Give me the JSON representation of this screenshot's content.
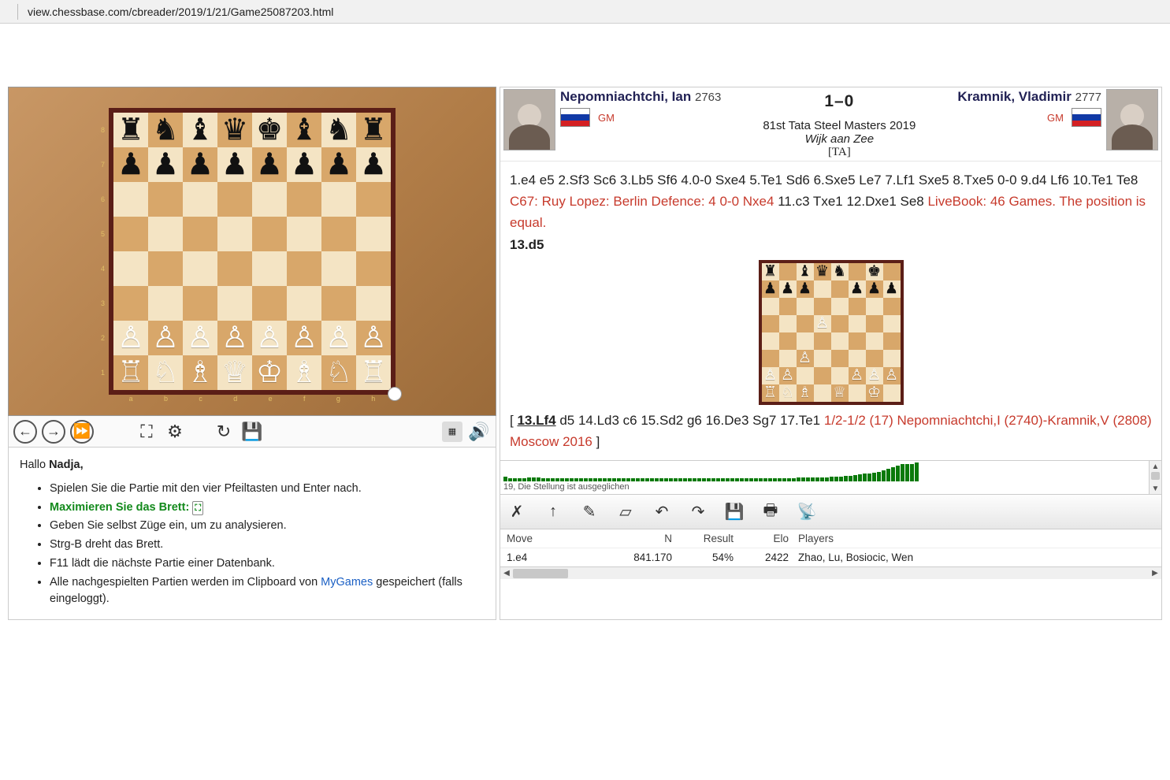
{
  "url_display": "view.chessbase.com/cbreader/2019/1/21/Game25087203.html",
  "board": {
    "ranks": [
      "8",
      "7",
      "6",
      "5",
      "4",
      "3",
      "2",
      "1"
    ],
    "files": [
      "a",
      "b",
      "c",
      "d",
      "e",
      "f",
      "g",
      "h"
    ],
    "position_main": [
      [
        "br",
        "bn",
        "bb",
        "bq",
        "bk",
        "bb",
        "bn",
        "br"
      ],
      [
        "bp",
        "bp",
        "bp",
        "bp",
        "bp",
        "bp",
        "bp",
        "bp"
      ],
      [
        "",
        "",
        "",
        "",
        "",
        "",
        "",
        ""
      ],
      [
        "",
        "",
        "",
        "",
        "",
        "",
        "",
        ""
      ],
      [
        "",
        "",
        "",
        "",
        "",
        "",
        "",
        ""
      ],
      [
        "",
        "",
        "",
        "",
        "",
        "",
        "",
        ""
      ],
      [
        "wp",
        "wp",
        "wp",
        "wp",
        "wp",
        "wp",
        "wp",
        "wp"
      ],
      [
        "wr",
        "wn",
        "wb",
        "wq",
        "wk",
        "wb",
        "wn",
        "wr"
      ]
    ],
    "position_mini": [
      [
        "br",
        "",
        "bb",
        "bq",
        "bn",
        "",
        "bk",
        ""
      ],
      [
        "bp",
        "bp",
        "bp",
        "",
        "",
        "bp",
        "bp",
        "bp"
      ],
      [
        "",
        "",
        "",
        "",
        "",
        "",
        "",
        ""
      ],
      [
        "",
        "",
        "",
        "wp",
        "",
        "",
        "",
        ""
      ],
      [
        "",
        "",
        "",
        "",
        "",
        "",
        "",
        ""
      ],
      [
        "",
        "",
        "wp",
        "",
        "",
        "",
        "",
        ""
      ],
      [
        "wp",
        "wp",
        "",
        "",
        "",
        "wp",
        "wp",
        "wp"
      ],
      [
        "wr",
        "wn",
        "wb",
        "",
        "wq",
        "",
        "wk",
        ""
      ]
    ]
  },
  "board_toolbar": {
    "back_icon": "←",
    "fwd_icon": "→",
    "ffwd_icon": "⏩",
    "expand_icon": "⛶",
    "engine_icon": "⚙",
    "reload_icon": "↻",
    "save_icon": "💾",
    "minimap_icon": "▦",
    "sound_icon": "🔊"
  },
  "help": {
    "hello": "Hallo",
    "user": "Nadja,",
    "l1": "Spielen Sie die Partie mit den vier Pfeiltasten und Enter nach.",
    "l2": "Maximieren Sie das Brett:",
    "l3": "Geben Sie selbst Züge ein, um zu analysieren.",
    "l4": "Strg-B dreht das Brett.",
    "l5": "F11 lädt die nächste Partie einer Datenbank.",
    "l6_pre": "Alle nachgespielten Partien werden im Clipboard von ",
    "l6_link": "MyGames",
    "l6_post": " gespeichert (falls eingeloggt)."
  },
  "game": {
    "white_name": "Nepomniachtchi, Ian",
    "white_elo": "2763",
    "white_title": "GM",
    "black_name": "Kramnik, Vladimir",
    "black_elo": "2777",
    "black_title": "GM",
    "result": "1–0",
    "event": "81st Tata Steel Masters 2019",
    "site": "Wijk aan Zee",
    "annotator": "[TA]"
  },
  "notation": {
    "line1": "1.e4 e5 2.Sf3 Sc6 3.Lb5 Sf6 4.0-0 Sxe4 5.Te1 Sd6 6.Sxe5 Le7 7.Lf1 Sxe5 8.Txe5 0-0 9.d4 Lf6 10.Te1 Te8 ",
    "ann1": "C67: Ruy Lopez: Berlin Defence: 4 0-0 Nxe4",
    "line2": " 11.c3 Txe1 12.Dxe1 Se8 ",
    "ann2": "LiveBook: 46 Games. The position is equal.",
    "line3": "13.d5",
    "var_open": "[ ",
    "var_move": "13.Lf4",
    "var_rest": " d5 14.Ld3 c6 15.Sd2 g6 16.De3 Sg7 17.Te1 ",
    "var_result": "1/2-1/2 (17) Nepomniachtchi,I (2740)-Kramnik,V (2808) Moscow 2016",
    "var_close": " ]"
  },
  "eval": {
    "text": "19, Die Stellung ist ausgeglichen",
    "bars": [
      6,
      4,
      4,
      4,
      4,
      5,
      5,
      5,
      4,
      4,
      4,
      4,
      4,
      4,
      4,
      4,
      4,
      4,
      4,
      4,
      4,
      4,
      4,
      4,
      4,
      4,
      4,
      4,
      4,
      4,
      4,
      4,
      4,
      4,
      4,
      4,
      4,
      4,
      4,
      4,
      4,
      4,
      4,
      4,
      4,
      4,
      4,
      4,
      4,
      4,
      4,
      4,
      4,
      4,
      4,
      4,
      4,
      4,
      4,
      4,
      4,
      4,
      5,
      5,
      5,
      5,
      5,
      5,
      5,
      6,
      6,
      6,
      7,
      7,
      8,
      9,
      10,
      10,
      11,
      12,
      14,
      16,
      18,
      20,
      22,
      22,
      22,
      24
    ]
  },
  "atoolbar": {
    "threat_icon": "✗",
    "promote_icon": "↑",
    "highlight_icon": "✎",
    "eraser_icon": "▱",
    "undo_icon": "↶",
    "redo_icon": "↷",
    "save_icon": "💾",
    "print_icon": "🖶",
    "broadcast_icon": "📡"
  },
  "table": {
    "h_move": "Move",
    "h_n": "N",
    "h_result": "Result",
    "h_elo": "Elo",
    "h_players": "Players",
    "r1_move": "1.e4",
    "r1_n": "841.170",
    "r1_result": "54%",
    "r1_elo": "2422",
    "r1_players": "Zhao, Lu, Bosiocic, Wen"
  }
}
